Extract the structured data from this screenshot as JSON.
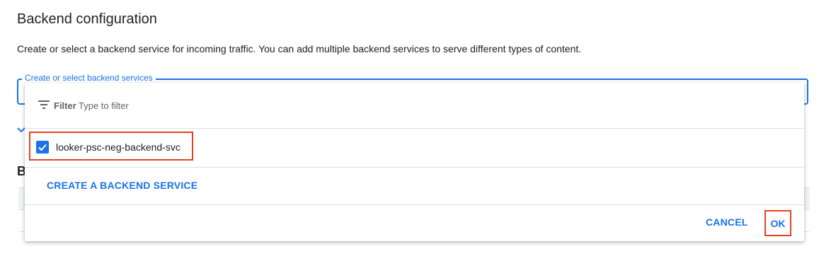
{
  "section": {
    "title": "Backend configuration",
    "description": "Create or select a backend service for incoming traffic. You can add multiple backend services to serve different types of content."
  },
  "field": {
    "label": "Create or select backend services"
  },
  "background": {
    "partial_heading": "B"
  },
  "menu": {
    "filter_label": "Filter",
    "filter_placeholder": "Type to filter",
    "options": [
      {
        "label": "looker-psc-neg-backend-svc",
        "checked": true
      }
    ],
    "create_label": "CREATE A BACKEND SERVICE",
    "cancel_label": "CANCEL",
    "ok_label": "OK"
  },
  "colors": {
    "accent": "#1a73e8",
    "highlight": "#e8411f"
  },
  "icons": {
    "filter": "filter-icon",
    "checkbox": "check-icon",
    "expand": "chevron-down-icon"
  }
}
